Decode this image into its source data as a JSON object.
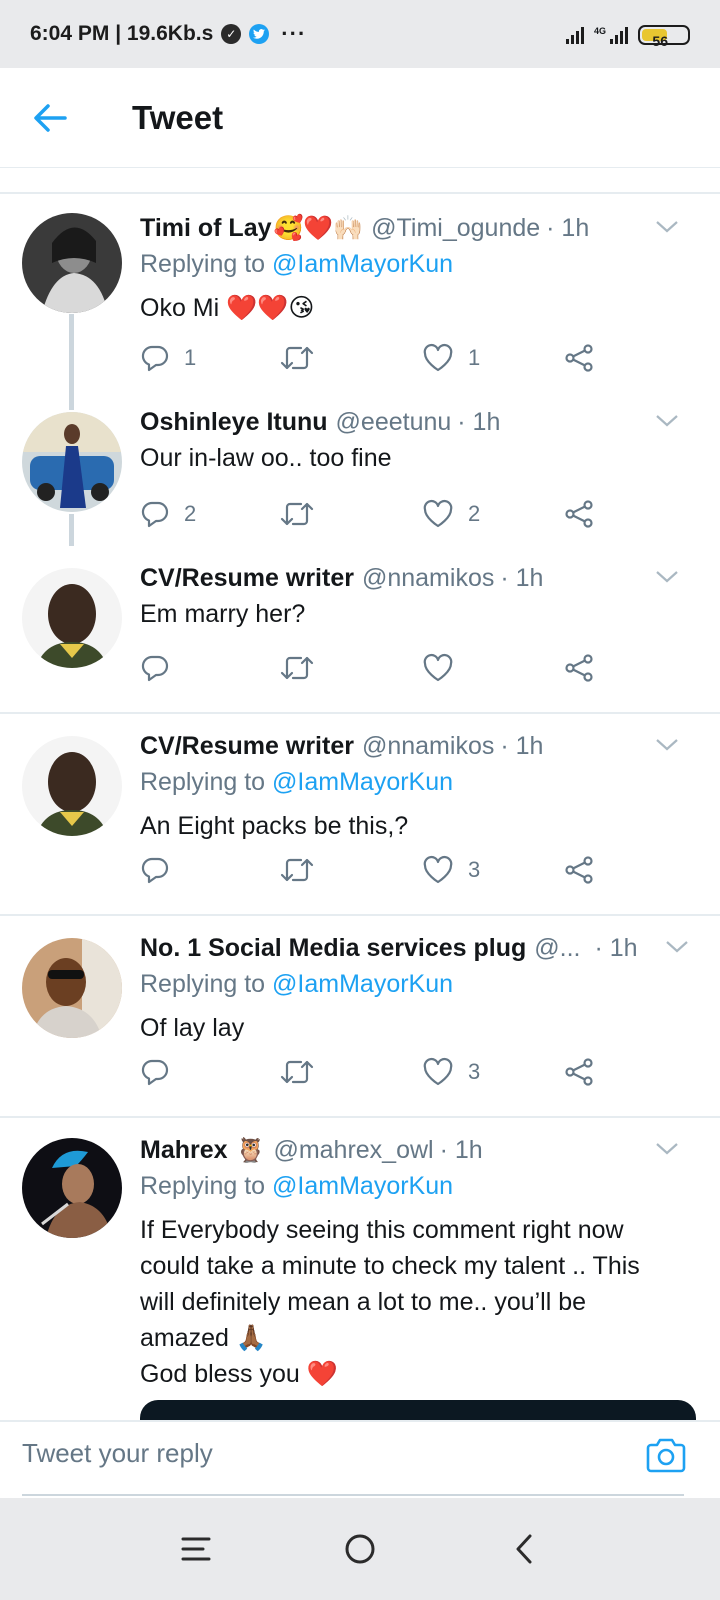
{
  "status_bar": {
    "time_speed": "6:04 PM | 19.6Kb.s",
    "more": "···",
    "network": "4G",
    "battery": "56"
  },
  "header": {
    "title": "Tweet"
  },
  "tweets": [
    {
      "name": "Timi of Lay",
      "name_emoji": "🥰❤️🙌🏻",
      "handle": "@Timi_ogunde",
      "time": "· 1h",
      "replying_prefix": "Replying to",
      "replying_to": "@IamMayorKun",
      "text": "Oko Mi ❤️❤️😘",
      "reply_count": "1",
      "retweet_count": "",
      "like_count": "1"
    },
    {
      "name": "Oshinleye Itunu",
      "name_emoji": "",
      "handle": "@eeetunu",
      "time": "· 1h",
      "text": "Our in-law oo.. too fine",
      "reply_count": "2",
      "retweet_count": "",
      "like_count": "2"
    },
    {
      "name": "CV/Resume writer",
      "name_emoji": "",
      "handle": "@nnamikos",
      "time": "· 1h",
      "text": "Em marry her?",
      "reply_count": "",
      "retweet_count": "",
      "like_count": ""
    },
    {
      "name": "CV/Resume writer",
      "name_emoji": "",
      "handle": "@nnamikos",
      "time": "· 1h",
      "replying_prefix": "Replying to",
      "replying_to": "@IamMayorKun",
      "text": "An Eight packs be this,?",
      "reply_count": "",
      "retweet_count": "",
      "like_count": "3"
    },
    {
      "name": "No. 1 Social Media services plug",
      "name_emoji": "",
      "handle": "@...",
      "time": "· 1h",
      "replying_prefix": "Replying to",
      "replying_to": "@IamMayorKun",
      "text": "Of lay lay",
      "reply_count": "",
      "retweet_count": "",
      "like_count": "3"
    },
    {
      "name": "Mahrex",
      "name_emoji": "🦉",
      "handle": "@mahrex_owl",
      "time": "· 1h",
      "replying_prefix": "Replying to",
      "replying_to": "@IamMayorKun",
      "text_lines": [
        "If Everybody seeing this comment right now",
        "could take a minute to check my talent .. This",
        "will definitely mean a lot to me.. you’ll be",
        "amazed 🙏🏾",
        "God bless you ❤️"
      ]
    }
  ],
  "reply_bar": {
    "placeholder": "Tweet your reply"
  },
  "colors": {
    "accent": "#1da1f2",
    "secondary_text": "#657786",
    "divider": "#e6ecf0"
  }
}
